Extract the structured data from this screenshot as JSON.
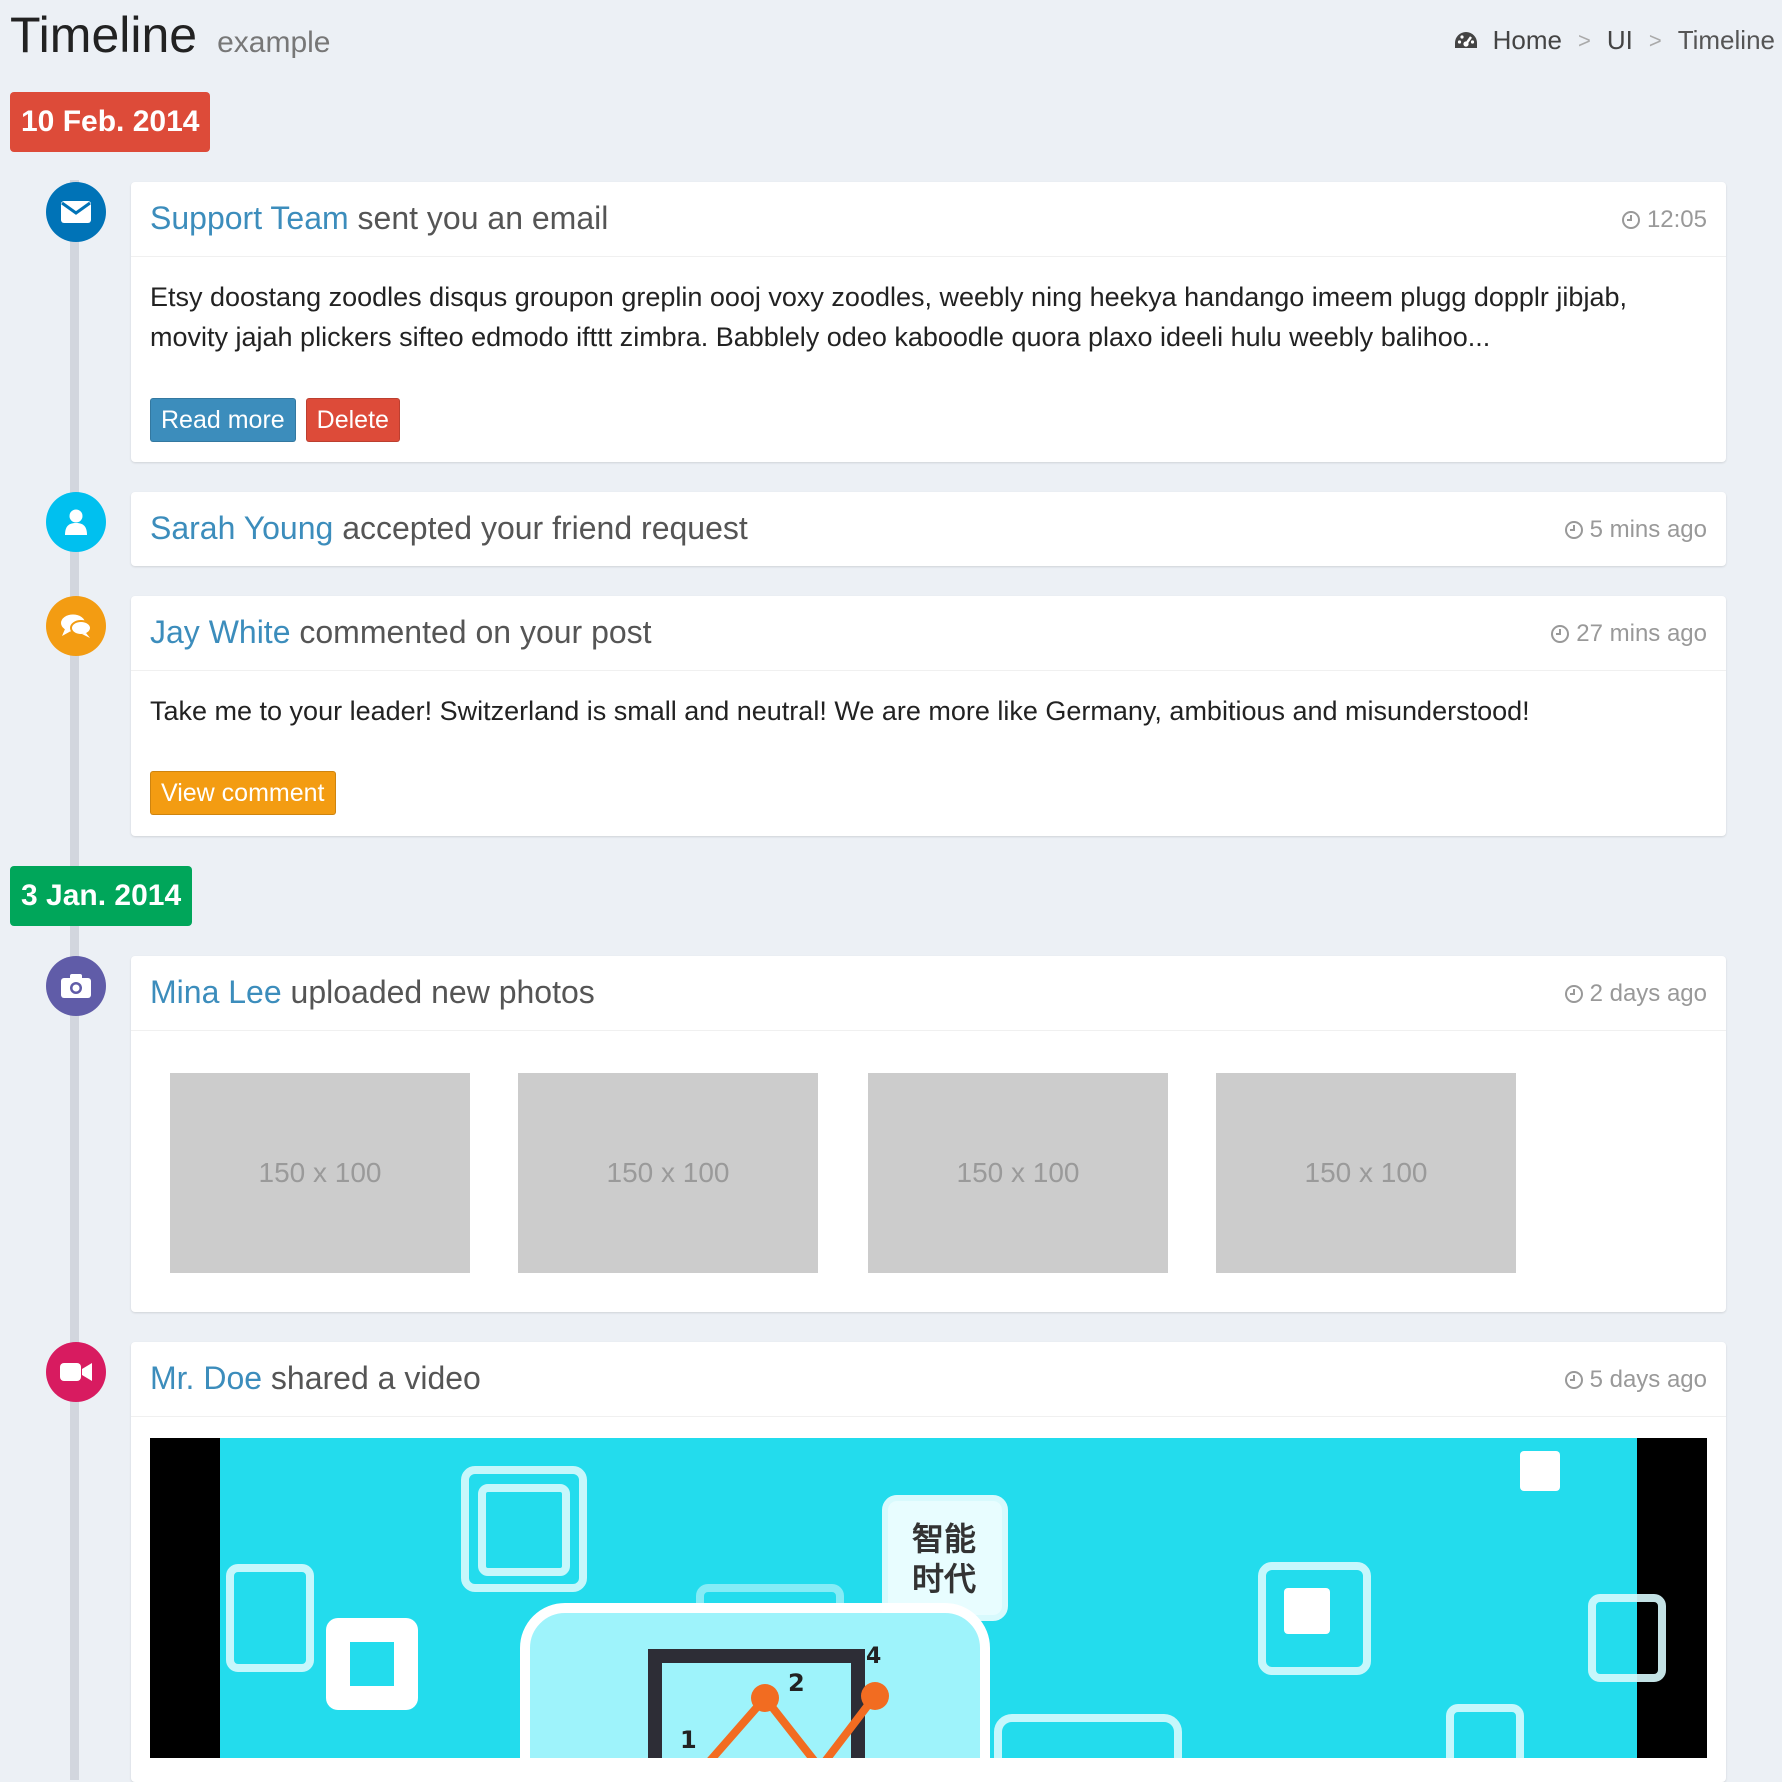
{
  "header": {
    "title": "Timeline",
    "subtitle": "example"
  },
  "breadcrumb": {
    "icon": "dashboard-icon",
    "items": [
      "Home",
      "UI",
      "Timeline"
    ],
    "separator": ">"
  },
  "dates": [
    {
      "label": "10 Feb. 2014",
      "color": "#dd4b39"
    },
    {
      "label": "3 Jan. 2014",
      "color": "#00a65a"
    }
  ],
  "items": [
    {
      "icon": "envelope-icon",
      "icon_color": "#0073b7",
      "actor": "Support Team",
      "action": "sent you an email",
      "time": "12:05",
      "body": "Etsy doostang zoodles disqus groupon greplin oooj voxy zoodles, weebly ning heekya handango imeem plugg dopplr jibjab, movity jajah plickers sifteo edmodo ifttt zimbra. Babblely odeo kaboodle quora plaxo ideeli hulu weebly balihoo...",
      "buttons": [
        {
          "label": "Read more",
          "color": "#3c8dbc"
        },
        {
          "label": "Delete",
          "color": "#dd4b39"
        }
      ]
    },
    {
      "icon": "user-icon",
      "icon_color": "#00c0ef",
      "actor": "Sarah Young",
      "action": "accepted your friend request",
      "time": "5 mins ago"
    },
    {
      "icon": "comments-icon",
      "icon_color": "#f39c12",
      "actor": "Jay White",
      "action": "commented on your post",
      "time": "27 mins ago",
      "body": "Take me to your leader! Switzerland is small and neutral! We are more like Germany, ambitious and misunderstood!",
      "buttons": [
        {
          "label": "View comment",
          "color": "#f39c12"
        }
      ]
    },
    {
      "icon": "camera-icon",
      "icon_color": "#605ca8",
      "actor": "Mina Lee",
      "action": "uploaded new photos",
      "time": "2 days ago",
      "photos": [
        "150 x 100",
        "150 x 100",
        "150 x 100",
        "150 x 100"
      ]
    },
    {
      "icon": "video-camera-icon",
      "icon_color": "#d81b60",
      "actor": "Mr. Doe",
      "action": "shared a video",
      "time": "5 days ago",
      "video_text": [
        "智能",
        "时代"
      ],
      "chart_points": [
        "1",
        "2",
        "4"
      ]
    }
  ]
}
